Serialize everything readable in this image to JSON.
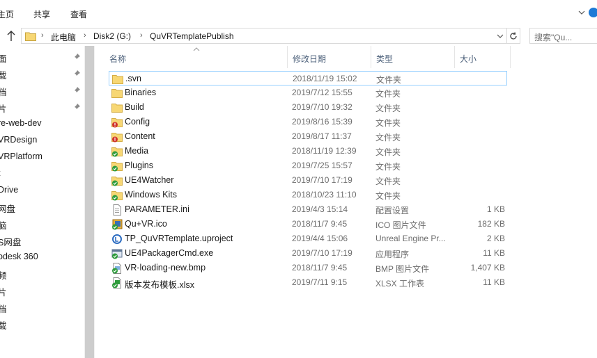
{
  "ribbon": {
    "tabs": [
      "主页",
      "共享",
      "查看"
    ]
  },
  "address": {
    "crumbs": [
      "此电脑",
      "Disk2 (G:)",
      "QuVRTemplatePublish"
    ],
    "search_placeholder": "搜索\"Qu..."
  },
  "nav": {
    "items": [
      {
        "label": "面",
        "pinned": true
      },
      {
        "label": "载",
        "pinned": true
      },
      {
        "label": "档",
        "pinned": true
      },
      {
        "label": "片",
        "pinned": true
      },
      {
        "label": "re-web-dev",
        "pinned": false
      },
      {
        "label": "VRDesign",
        "pinned": false
      },
      {
        "label": "VRPlatform",
        "pinned": false
      },
      {
        "label": "t",
        "pinned": false
      },
      {
        "label": "Drive",
        "pinned": false
      },
      {
        "label": "网盘",
        "pinned": false
      },
      {
        "label": "脑",
        "pinned": false
      },
      {
        "label": "S网盘",
        "pinned": false
      },
      {
        "label": "odesk 360",
        "pinned": false
      },
      {
        "label": "频",
        "pinned": false
      },
      {
        "label": "片",
        "pinned": false
      },
      {
        "label": "档",
        "pinned": false
      },
      {
        "label": "载",
        "pinned": false
      }
    ]
  },
  "columns": {
    "name": "名称",
    "date": "修改日期",
    "type": "类型",
    "size": "大小"
  },
  "files": [
    {
      "icon": "folder-icon",
      "name": ".svn",
      "date": "2018/11/19 15:02",
      "type": "文件夹",
      "size": "",
      "selected": true
    },
    {
      "icon": "folder-icon",
      "name": "Binaries",
      "date": "2019/7/12 15:55",
      "type": "文件夹",
      "size": ""
    },
    {
      "icon": "folder-icon",
      "name": "Build",
      "date": "2019/7/10 19:32",
      "type": "文件夹",
      "size": ""
    },
    {
      "icon": "folder-conflict-icon",
      "name": "Config",
      "date": "2019/8/16 15:39",
      "type": "文件夹",
      "size": ""
    },
    {
      "icon": "folder-conflict-icon",
      "name": "Content",
      "date": "2019/8/17 11:37",
      "type": "文件夹",
      "size": ""
    },
    {
      "icon": "folder-ok-icon",
      "name": "Media",
      "date": "2018/11/19 12:39",
      "type": "文件夹",
      "size": ""
    },
    {
      "icon": "folder-ok-icon",
      "name": "Plugins",
      "date": "2019/7/25 15:57",
      "type": "文件夹",
      "size": ""
    },
    {
      "icon": "folder-ok-icon",
      "name": "UE4Watcher",
      "date": "2019/7/10 17:19",
      "type": "文件夹",
      "size": ""
    },
    {
      "icon": "folder-ok-icon",
      "name": "Windows Kits",
      "date": "2018/10/23 11:10",
      "type": "文件夹",
      "size": ""
    },
    {
      "icon": "ini-file-icon",
      "name": "PARAMETER.ini",
      "date": "2019/4/3 15:14",
      "type": "配置设置",
      "size": "1 KB"
    },
    {
      "icon": "ico-file-ok-icon",
      "name": "Qu+VR.ico",
      "date": "2018/11/7 9:45",
      "type": "ICO 图片文件",
      "size": "182 KB"
    },
    {
      "icon": "uproject-file-icon",
      "name": "TP_QuVRTemplate.uproject",
      "date": "2019/4/4 15:06",
      "type": "Unreal Engine Pr...",
      "size": "2 KB"
    },
    {
      "icon": "exe-file-ok-icon",
      "name": "UE4PackagerCmd.exe",
      "date": "2019/7/10 17:19",
      "type": "应用程序",
      "size": "11 KB"
    },
    {
      "icon": "bmp-file-ok-icon",
      "name": "VR-loading-new.bmp",
      "date": "2018/11/7 9:45",
      "type": "BMP 图片文件",
      "size": "1,407 KB"
    },
    {
      "icon": "xlsx-file-ok-icon",
      "name": "版本发布模板.xlsx",
      "date": "2019/7/11 9:15",
      "type": "XLSX 工作表",
      "size": "11 KB"
    }
  ]
}
